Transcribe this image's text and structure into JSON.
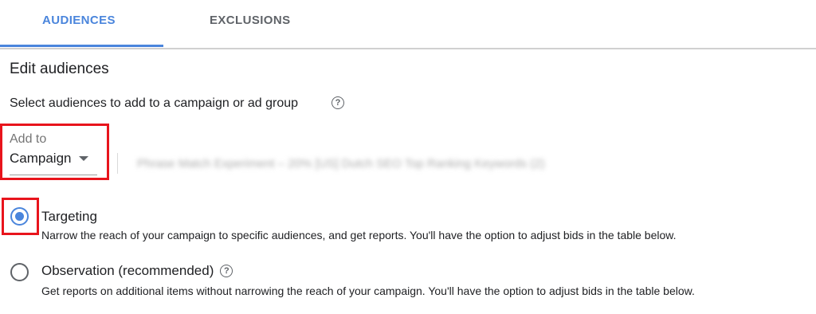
{
  "tabs": [
    {
      "label": "AUDIENCES",
      "active": true
    },
    {
      "label": "EXCLUSIONS",
      "active": false
    }
  ],
  "heading": "Edit audiences",
  "subheading": "Select audiences to add to a campaign or ad group",
  "add_to": {
    "label": "Add to",
    "selected": "Campaign",
    "campaign_name": "Phrase Match Experiment – 20% [US] Dutch SEO Top Ranking Keywords (2)"
  },
  "options": [
    {
      "label": "Targeting",
      "description": "Narrow the reach of your campaign to specific audiences, and get reports. You'll have the option to adjust bids in the table below.",
      "checked": true
    },
    {
      "label": "Observation (recommended)",
      "description": "Get reports on additional items without narrowing the reach of your campaign. You'll have the option to adjust bids in the table below.",
      "checked": false
    }
  ],
  "colors": {
    "accent": "#4a85dc",
    "highlight": "#e8141c"
  },
  "icons": {
    "help": "help-circle-icon",
    "dropdown": "caret-down-icon"
  }
}
